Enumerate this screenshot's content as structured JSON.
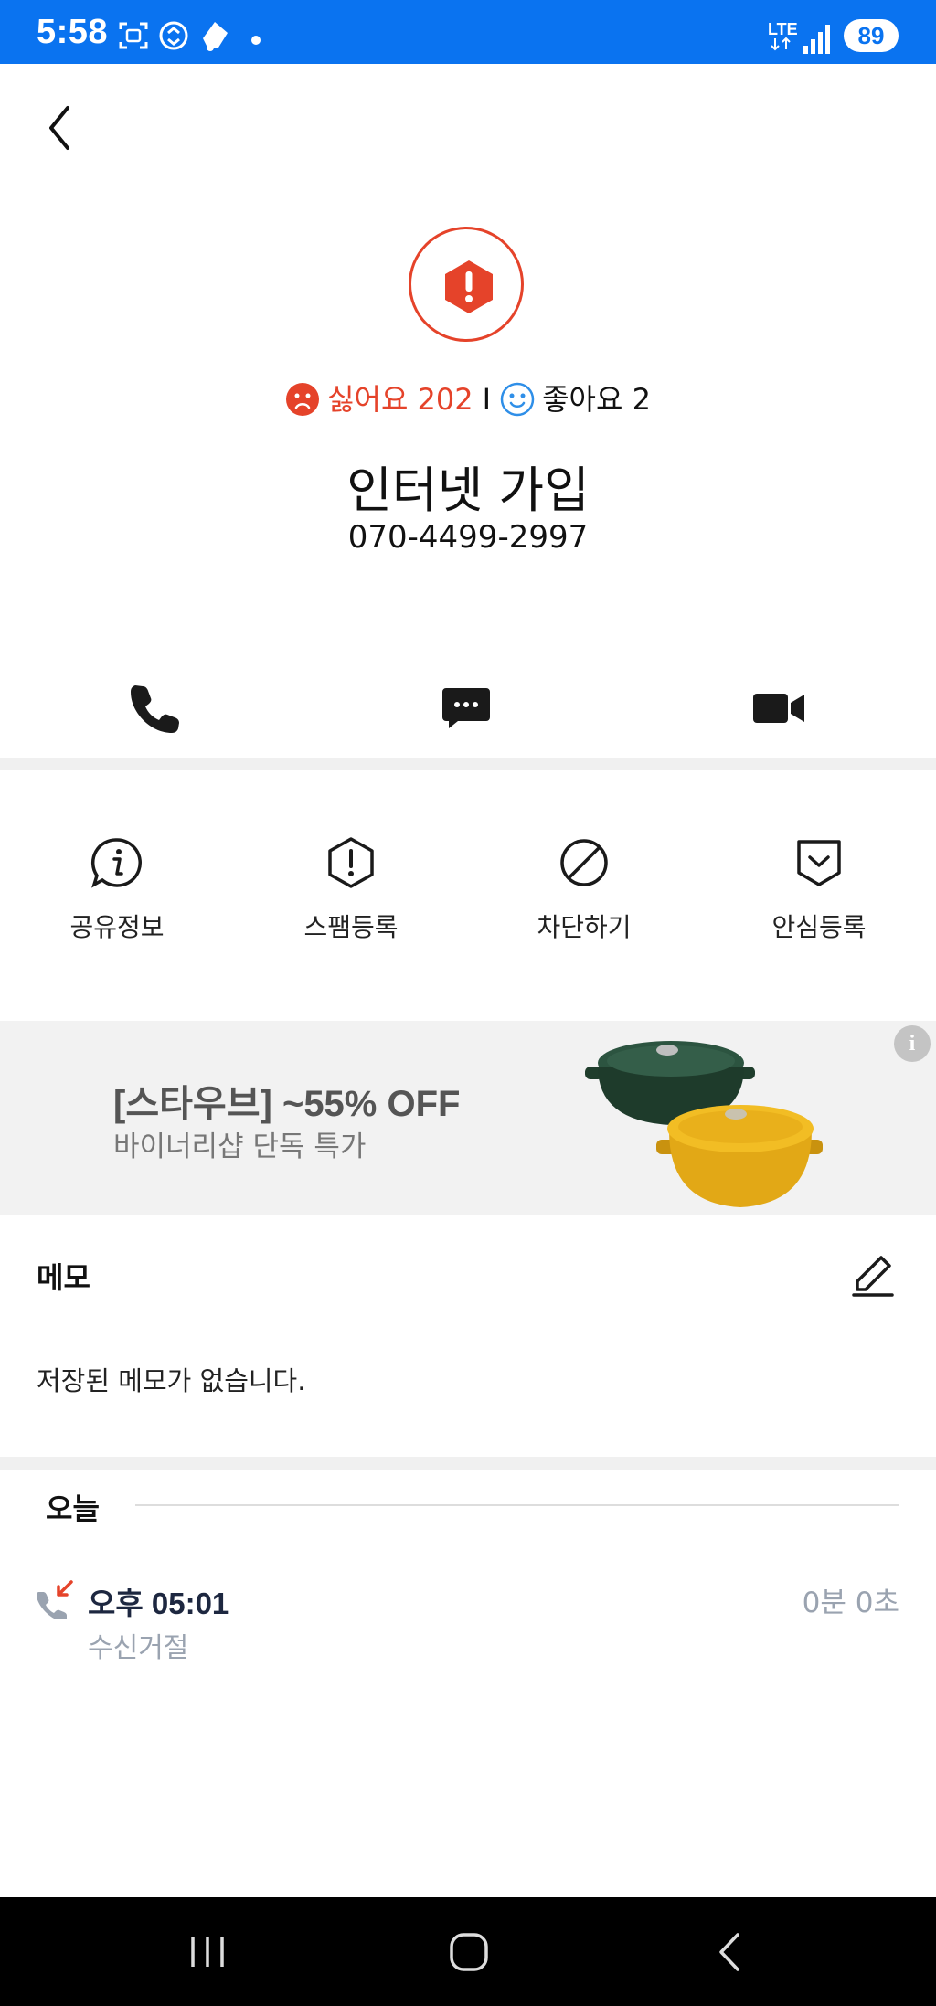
{
  "status_bar": {
    "time": "5:58",
    "network": "LTE",
    "battery": "89",
    "icons": [
      "screenshot-icon",
      "data-saver-icon",
      "app-icon",
      "notification-dot-icon",
      "signal-icon"
    ]
  },
  "header": {
    "back_icon": "chevron-left-icon"
  },
  "profile": {
    "warning_icon": "exclamation-hexagon-icon",
    "dislike_label": "싫어요 202",
    "separator": "I",
    "like_label": "좋아요 2",
    "name": "인터넷 가입",
    "number": "070-4499-2997"
  },
  "actions": [
    {
      "icon": "phone-icon"
    },
    {
      "icon": "message-icon"
    },
    {
      "icon": "video-call-icon"
    }
  ],
  "quick_menu": [
    {
      "label": "공유정보",
      "icon": "info-icon"
    },
    {
      "label": "스팸등록",
      "icon": "spam-report-icon"
    },
    {
      "label": "차단하기",
      "icon": "block-icon"
    },
    {
      "label": "안심등록",
      "icon": "safe-register-icon"
    }
  ],
  "ad": {
    "title": "[스타우브] ~55% OFF",
    "subtitle": "바이너리샵 단독 특가",
    "info": "i"
  },
  "memo": {
    "title": "메모",
    "empty_text": "저장된 메모가 없습니다.",
    "edit_icon": "pencil-icon"
  },
  "history": {
    "section_label": "오늘",
    "entries": [
      {
        "time": "오후 05:01",
        "status": "수신거절",
        "duration": "0분 0초",
        "icon": "rejected-call-icon"
      }
    ]
  },
  "nav_bar": {
    "buttons": [
      "recent-apps-icon",
      "home-icon",
      "back-icon"
    ]
  },
  "colors": {
    "status_bar": "#0a73f0",
    "accent_red": "#e5432a",
    "like_blue": "#2f8fe8",
    "muted": "#9aa3b0"
  }
}
